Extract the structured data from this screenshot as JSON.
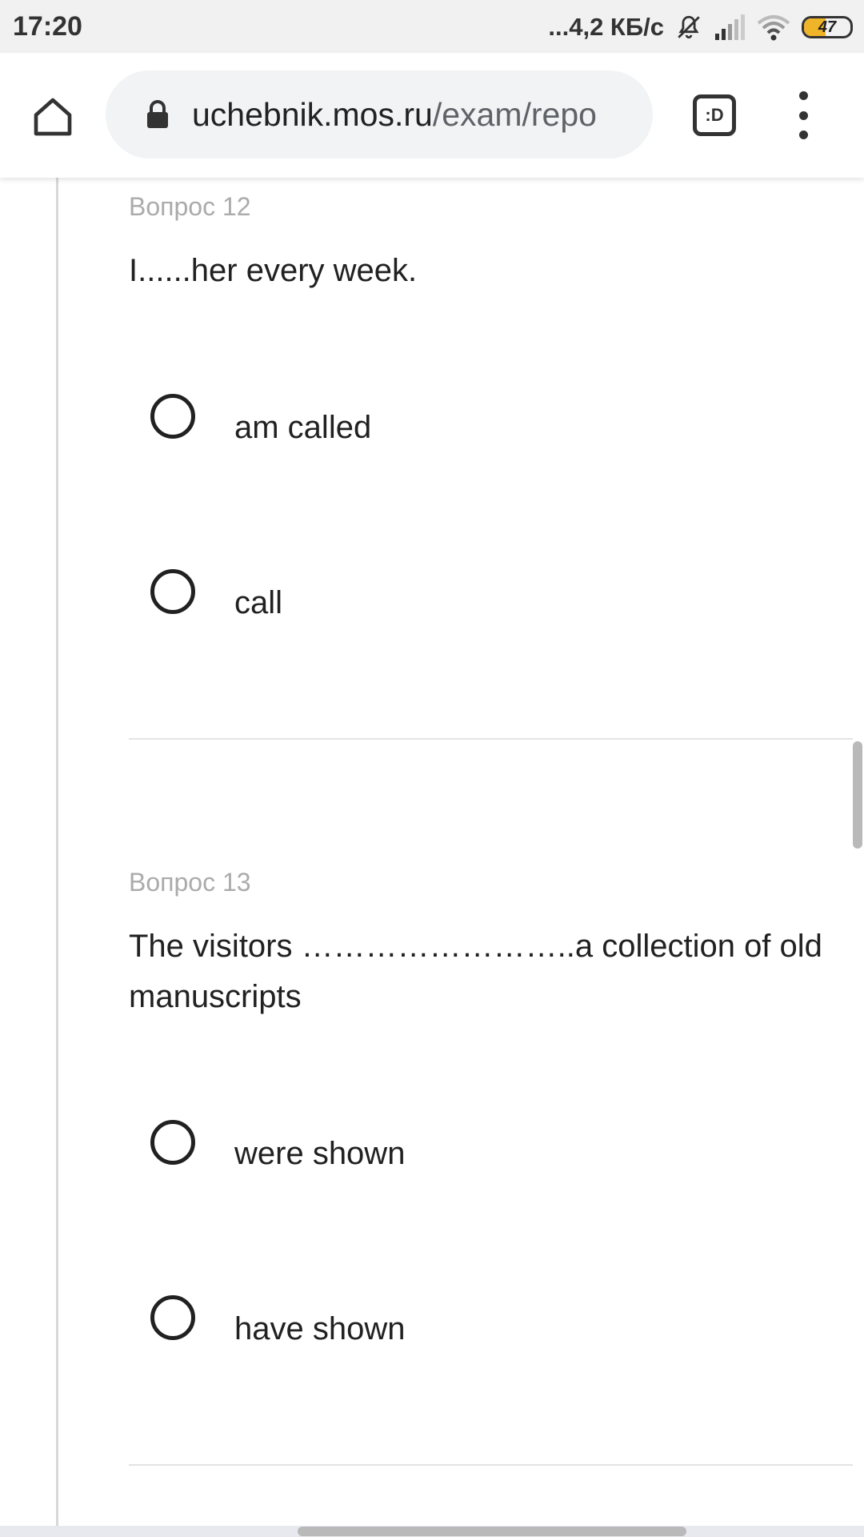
{
  "status_bar": {
    "time": "17:20",
    "network_speed": "...4,2 КБ/с",
    "battery_level": "47",
    "icons": [
      "bell-off-icon",
      "signal-icon",
      "wifi-icon",
      "battery-icon"
    ]
  },
  "browser": {
    "url_host": "uchebnik.mos.ru",
    "url_path": "/exam/repo",
    "tabs_label": ":D",
    "icons": [
      "home-icon",
      "lock-icon",
      "tabs-icon",
      "more-vert-icon"
    ]
  },
  "questions": [
    {
      "label": "Вопрос 12",
      "text": "I......her every week.",
      "options": [
        "am called",
        "call"
      ]
    },
    {
      "label": "Вопрос 13",
      "text": "The visitors ……………………..a collection of old manuscripts",
      "options": [
        "were shown",
        "have shown"
      ]
    }
  ],
  "colors": {
    "status_bar_bg": "#f1f1f1",
    "omnibox_bg": "#f1f3f4",
    "battery_fill": "#f0b429",
    "muted_label": "#ababab"
  }
}
